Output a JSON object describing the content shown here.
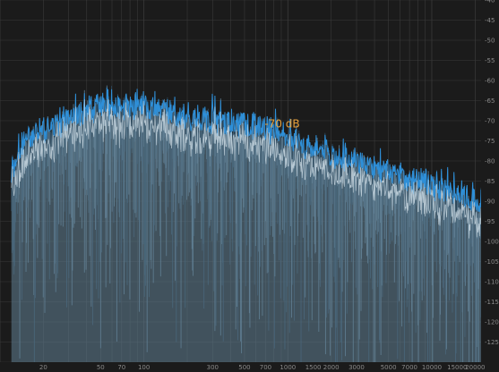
{
  "chart_data": {
    "type": "area",
    "colors": {
      "background": "#1b1b1b",
      "grid": "#3a3a3a",
      "fill": "#607f94",
      "fill_dark": "#2f4a5e",
      "trace_blue": "#2e8fd8",
      "trace_light": "#d8e6ee",
      "tick_label": "#8a8a8a",
      "annotation": "#e8a23c"
    },
    "x_scale": "log",
    "xlim": [
      10,
      22000
    ],
    "ylim": [
      -130,
      -40
    ],
    "grid": true,
    "x_ticks": [
      {
        "value": 20,
        "label": "20"
      },
      {
        "value": 50,
        "label": "50"
      },
      {
        "value": 70,
        "label": "70"
      },
      {
        "value": 100,
        "label": "100"
      },
      {
        "value": 300,
        "label": "300"
      },
      {
        "value": 500,
        "label": "500"
      },
      {
        "value": 700,
        "label": "700"
      },
      {
        "value": 1000,
        "label": "1000"
      },
      {
        "value": 1500,
        "label": "1500"
      },
      {
        "value": 2000,
        "label": "2000"
      },
      {
        "value": 3000,
        "label": "3000"
      },
      {
        "value": 5000,
        "label": "5000"
      },
      {
        "value": 7000,
        "label": "7000"
      },
      {
        "value": 10000,
        "label": "10000"
      },
      {
        "value": 15000,
        "label": "15000"
      },
      {
        "value": 20000,
        "label": "20000"
      }
    ],
    "y_ticks": [
      "-40",
      "-45",
      "-50",
      "-55",
      "-60",
      "-65",
      "-70",
      "-75",
      "-80",
      "-85",
      "-90",
      "-95",
      "-100",
      "-105",
      "-110",
      "-115",
      "-120",
      "-125"
    ],
    "annotations": [
      {
        "text": "-70 dB",
        "x": 1000,
        "y": -70.8
      }
    ],
    "envelope_x": [
      12,
      15,
      20,
      30,
      50,
      70,
      100,
      150,
      200,
      300,
      500,
      700,
      1000,
      1500,
      2000,
      3000,
      5000,
      7000,
      10000,
      15000,
      20000,
      22000
    ],
    "envelope_y": [
      -82,
      -74,
      -72,
      -70,
      -66,
      -67,
      -66,
      -68,
      -69,
      -70,
      -71,
      -72,
      -74,
      -77,
      -78,
      -80,
      -83,
      -85,
      -86,
      -88,
      -90,
      -92
    ]
  }
}
